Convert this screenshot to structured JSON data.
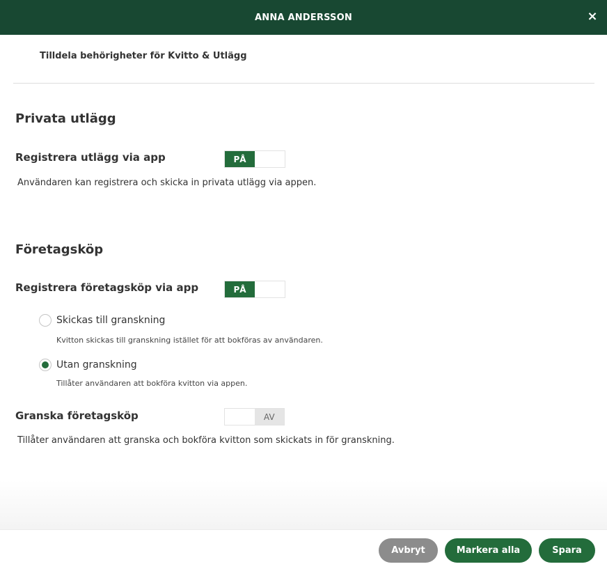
{
  "header": {
    "title": "ANNA ANDERSSON",
    "close_label": "×"
  },
  "subtitle": "Tilldela behörigheter för Kvitto & Utlägg",
  "private": {
    "section_title": "Privata utlägg",
    "register": {
      "label": "Registrera utlägg via app",
      "toggle_on_label": "PÅ",
      "state": "on",
      "description": "Användaren kan registrera och skicka in privata utlägg via appen."
    }
  },
  "company": {
    "section_title": "Företagsköp",
    "register": {
      "label": "Registrera företagsköp via app",
      "toggle_on_label": "PÅ",
      "state": "on"
    },
    "options": [
      {
        "label": "Skickas till granskning",
        "description": "Kvitton skickas till granskning istället för att bokföras av användaren.",
        "selected": false
      },
      {
        "label": "Utan granskning",
        "description": "Tillåter användaren att bokföra kvitton via appen.",
        "selected": true
      }
    ],
    "review": {
      "label": "Granska företagsköp",
      "toggle_off_label": "AV",
      "state": "off",
      "description": "Tillåter användaren att granska och bokföra kvitton som skickats in för granskning."
    }
  },
  "footer": {
    "cancel_label": "Avbryt",
    "mark_all_label": "Markera alla",
    "save_label": "Spara"
  },
  "colors": {
    "header_bg": "#184832",
    "accent": "#236c3b",
    "cancel_bg": "#8c8c8c"
  }
}
